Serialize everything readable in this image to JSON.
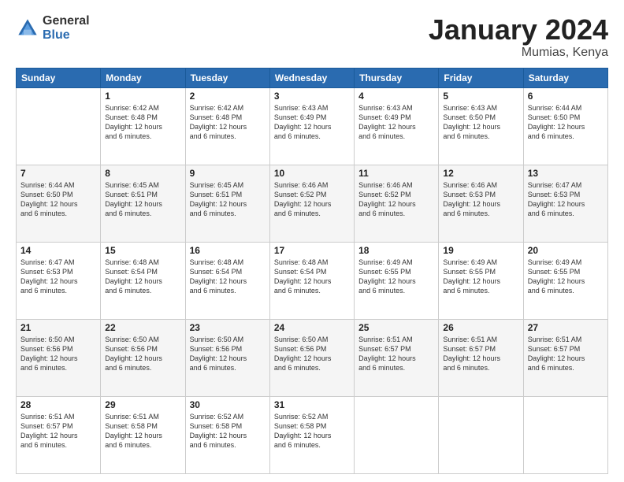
{
  "logo": {
    "general": "General",
    "blue": "Blue"
  },
  "title": {
    "month": "January 2024",
    "location": "Mumias, Kenya"
  },
  "weekdays": [
    "Sunday",
    "Monday",
    "Tuesday",
    "Wednesday",
    "Thursday",
    "Friday",
    "Saturday"
  ],
  "weeks": [
    [
      {
        "day": "",
        "info": ""
      },
      {
        "day": "1",
        "info": "Sunrise: 6:42 AM\nSunset: 6:48 PM\nDaylight: 12 hours\nand 6 minutes."
      },
      {
        "day": "2",
        "info": "Sunrise: 6:42 AM\nSunset: 6:48 PM\nDaylight: 12 hours\nand 6 minutes."
      },
      {
        "day": "3",
        "info": "Sunrise: 6:43 AM\nSunset: 6:49 PM\nDaylight: 12 hours\nand 6 minutes."
      },
      {
        "day": "4",
        "info": "Sunrise: 6:43 AM\nSunset: 6:49 PM\nDaylight: 12 hours\nand 6 minutes."
      },
      {
        "day": "5",
        "info": "Sunrise: 6:43 AM\nSunset: 6:50 PM\nDaylight: 12 hours\nand 6 minutes."
      },
      {
        "day": "6",
        "info": "Sunrise: 6:44 AM\nSunset: 6:50 PM\nDaylight: 12 hours\nand 6 minutes."
      }
    ],
    [
      {
        "day": "7",
        "info": "Sunrise: 6:44 AM\nSunset: 6:50 PM\nDaylight: 12 hours\nand 6 minutes."
      },
      {
        "day": "8",
        "info": "Sunrise: 6:45 AM\nSunset: 6:51 PM\nDaylight: 12 hours\nand 6 minutes."
      },
      {
        "day": "9",
        "info": "Sunrise: 6:45 AM\nSunset: 6:51 PM\nDaylight: 12 hours\nand 6 minutes."
      },
      {
        "day": "10",
        "info": "Sunrise: 6:46 AM\nSunset: 6:52 PM\nDaylight: 12 hours\nand 6 minutes."
      },
      {
        "day": "11",
        "info": "Sunrise: 6:46 AM\nSunset: 6:52 PM\nDaylight: 12 hours\nand 6 minutes."
      },
      {
        "day": "12",
        "info": "Sunrise: 6:46 AM\nSunset: 6:53 PM\nDaylight: 12 hours\nand 6 minutes."
      },
      {
        "day": "13",
        "info": "Sunrise: 6:47 AM\nSunset: 6:53 PM\nDaylight: 12 hours\nand 6 minutes."
      }
    ],
    [
      {
        "day": "14",
        "info": "Sunrise: 6:47 AM\nSunset: 6:53 PM\nDaylight: 12 hours\nand 6 minutes."
      },
      {
        "day": "15",
        "info": "Sunrise: 6:48 AM\nSunset: 6:54 PM\nDaylight: 12 hours\nand 6 minutes."
      },
      {
        "day": "16",
        "info": "Sunrise: 6:48 AM\nSunset: 6:54 PM\nDaylight: 12 hours\nand 6 minutes."
      },
      {
        "day": "17",
        "info": "Sunrise: 6:48 AM\nSunset: 6:54 PM\nDaylight: 12 hours\nand 6 minutes."
      },
      {
        "day": "18",
        "info": "Sunrise: 6:49 AM\nSunset: 6:55 PM\nDaylight: 12 hours\nand 6 minutes."
      },
      {
        "day": "19",
        "info": "Sunrise: 6:49 AM\nSunset: 6:55 PM\nDaylight: 12 hours\nand 6 minutes."
      },
      {
        "day": "20",
        "info": "Sunrise: 6:49 AM\nSunset: 6:55 PM\nDaylight: 12 hours\nand 6 minutes."
      }
    ],
    [
      {
        "day": "21",
        "info": "Sunrise: 6:50 AM\nSunset: 6:56 PM\nDaylight: 12 hours\nand 6 minutes."
      },
      {
        "day": "22",
        "info": "Sunrise: 6:50 AM\nSunset: 6:56 PM\nDaylight: 12 hours\nand 6 minutes."
      },
      {
        "day": "23",
        "info": "Sunrise: 6:50 AM\nSunset: 6:56 PM\nDaylight: 12 hours\nand 6 minutes."
      },
      {
        "day": "24",
        "info": "Sunrise: 6:50 AM\nSunset: 6:56 PM\nDaylight: 12 hours\nand 6 minutes."
      },
      {
        "day": "25",
        "info": "Sunrise: 6:51 AM\nSunset: 6:57 PM\nDaylight: 12 hours\nand 6 minutes."
      },
      {
        "day": "26",
        "info": "Sunrise: 6:51 AM\nSunset: 6:57 PM\nDaylight: 12 hours\nand 6 minutes."
      },
      {
        "day": "27",
        "info": "Sunrise: 6:51 AM\nSunset: 6:57 PM\nDaylight: 12 hours\nand 6 minutes."
      }
    ],
    [
      {
        "day": "28",
        "info": "Sunrise: 6:51 AM\nSunset: 6:57 PM\nDaylight: 12 hours\nand 6 minutes."
      },
      {
        "day": "29",
        "info": "Sunrise: 6:51 AM\nSunset: 6:58 PM\nDaylight: 12 hours\nand 6 minutes."
      },
      {
        "day": "30",
        "info": "Sunrise: 6:52 AM\nSunset: 6:58 PM\nDaylight: 12 hours\nand 6 minutes."
      },
      {
        "day": "31",
        "info": "Sunrise: 6:52 AM\nSunset: 6:58 PM\nDaylight: 12 hours\nand 6 minutes."
      },
      {
        "day": "",
        "info": ""
      },
      {
        "day": "",
        "info": ""
      },
      {
        "day": "",
        "info": ""
      }
    ]
  ]
}
